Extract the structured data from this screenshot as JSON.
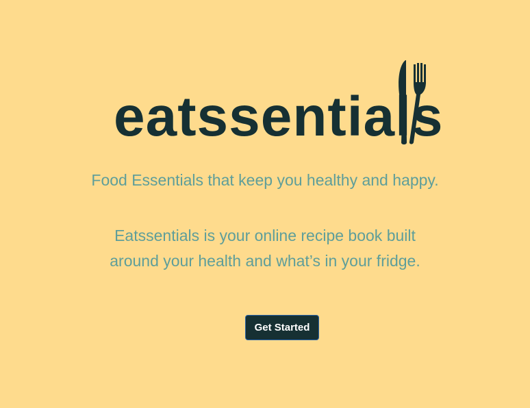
{
  "logo": {
    "text": "eatssentials",
    "icon": "fork-knife-icon"
  },
  "hero": {
    "tagline": "Food Essentials that keep you healthy and happy.",
    "description_line1": "Eatssentials is your online recipe book built",
    "description_line2": "around your health and what’s in your fridge."
  },
  "cta": {
    "label": "Get Started"
  },
  "colors": {
    "background": "#FEDB8D",
    "brand_dark": "#163033",
    "text_teal": "#5E9E9A",
    "button_border": "#2A64A8"
  }
}
